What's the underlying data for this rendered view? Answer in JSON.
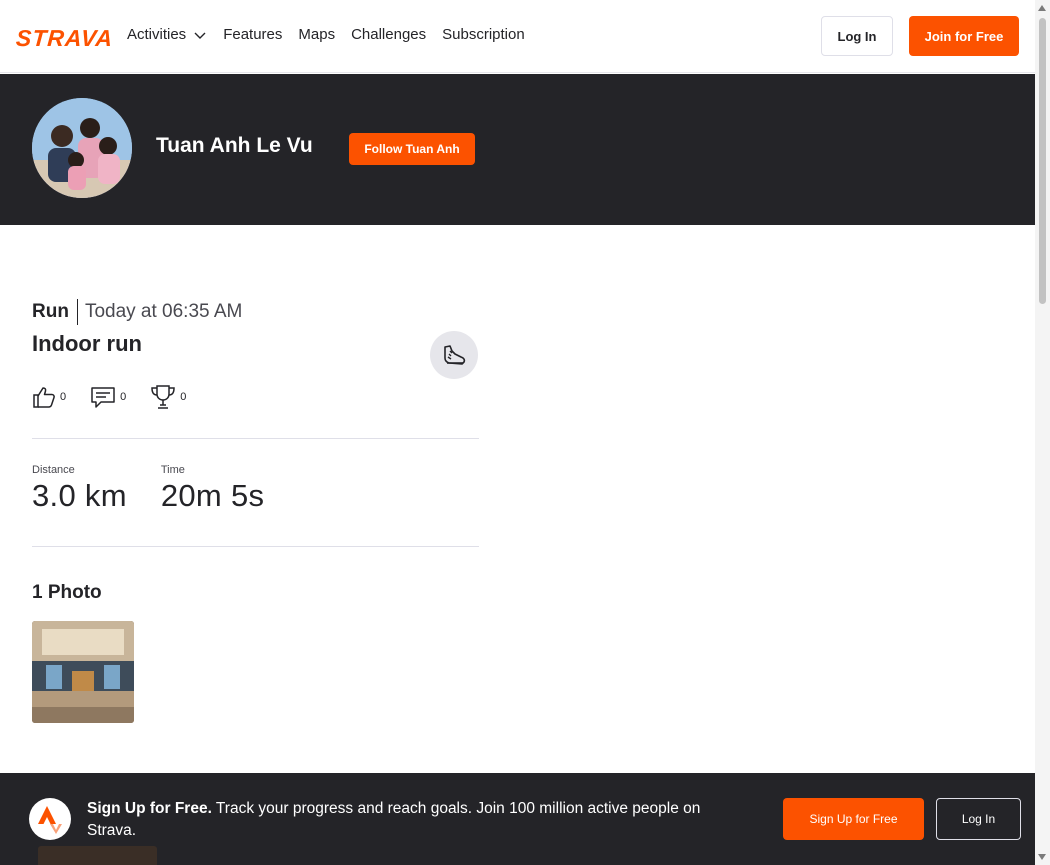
{
  "brand": {
    "logo_text": "STRAVA",
    "accent": "#fc5200",
    "dark": "#242428"
  },
  "nav": {
    "items": [
      {
        "label": "Activities",
        "has_dropdown": true
      },
      {
        "label": "Features"
      },
      {
        "label": "Maps"
      },
      {
        "label": "Challenges"
      },
      {
        "label": "Subscription"
      }
    ],
    "login_label": "Log In",
    "join_label": "Join for Free"
  },
  "athlete": {
    "name": "Tuan Anh Le Vu",
    "follow_label": "Follow Tuan Anh"
  },
  "activity": {
    "type": "Run",
    "time": "Today at 06:35 AM",
    "name": "Indoor run",
    "sport_icon": "shoe-icon",
    "kudos_count": "0",
    "comments_count": "0",
    "achievements_count": "0",
    "stats": [
      {
        "label": "Distance",
        "value": "3.0 km"
      },
      {
        "label": "Time",
        "value": "20m 5s"
      }
    ],
    "photos_title": "1 Photo"
  },
  "signup_banner": {
    "headline": "Sign Up for Free.",
    "text": " Track your progress and reach goals. Join 100 million active people on Strava.",
    "signup_label": "Sign Up for Free",
    "login_label": "Log In"
  }
}
